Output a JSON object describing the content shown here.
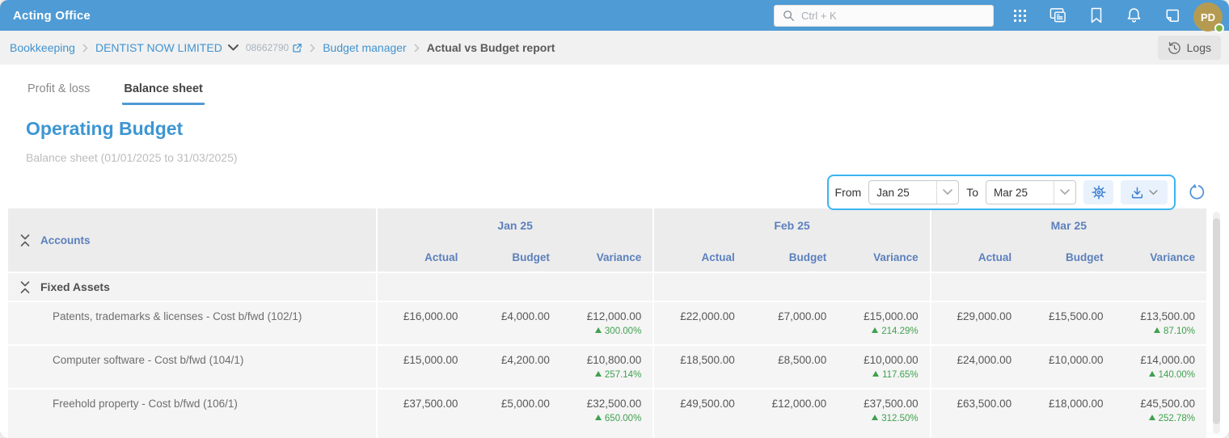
{
  "topbar": {
    "app_title": "Acting Office",
    "search_placeholder": "Ctrl + K",
    "avatar_initials": "PD",
    "icon_names": [
      "search-icon",
      "apps-grid-icon",
      "app-window-icon",
      "bookmark-icon",
      "notifications-bell-icon",
      "sticky-note-icon",
      "avatar-status-dot"
    ]
  },
  "breadcrumb": {
    "items": [
      "Bookkeeping",
      "DENTIST NOW LIMITED",
      "08662790",
      "Budget manager",
      "Actual vs Budget report"
    ],
    "logs_label": "Logs",
    "icon_names": [
      "company-dropdown-chevron-icon",
      "external-link-icon",
      "history-icon"
    ]
  },
  "tabs": {
    "profit_loss": "Profit & loss",
    "balance_sheet": "Balance sheet",
    "active": "Balance sheet"
  },
  "page": {
    "title": "Operating Budget",
    "subtitle": "Balance sheet (01/01/2025 to 31/03/2025)"
  },
  "filters": {
    "from_label": "From",
    "from_value": "Jan 25",
    "to_label": "To",
    "to_value": "Mar 25",
    "icon_names": [
      "gear-icon",
      "download-icon",
      "chevron-down-icon",
      "refresh-icon"
    ]
  },
  "table": {
    "accounts_header": "Accounts",
    "months": [
      "Jan 25",
      "Feb 25",
      "Mar 25"
    ],
    "sub_headers": [
      "Actual",
      "Budget",
      "Variance"
    ],
    "group_label": "Fixed Assets",
    "rows": [
      {
        "account": "Patents, trademarks & licenses - Cost b/fwd (102/1)",
        "months": [
          {
            "actual": "£16,000.00",
            "budget": "£4,000.00",
            "variance": "£12,000.00",
            "variance_pct": "300.00%"
          },
          {
            "actual": "£22,000.00",
            "budget": "£7,000.00",
            "variance": "£15,000.00",
            "variance_pct": "214.29%"
          },
          {
            "actual": "£29,000.00",
            "budget": "£15,500.00",
            "variance": "£13,500.00",
            "variance_pct": "87.10%"
          }
        ]
      },
      {
        "account": "Computer software - Cost b/fwd (104/1)",
        "months": [
          {
            "actual": "£15,000.00",
            "budget": "£4,200.00",
            "variance": "£10,800.00",
            "variance_pct": "257.14%"
          },
          {
            "actual": "£18,500.00",
            "budget": "£8,500.00",
            "variance": "£10,000.00",
            "variance_pct": "117.65%"
          },
          {
            "actual": "£24,000.00",
            "budget": "£10,000.00",
            "variance": "£14,000.00",
            "variance_pct": "140.00%"
          }
        ]
      },
      {
        "account": "Freehold property - Cost b/fwd (106/1)",
        "months": [
          {
            "actual": "£37,500.00",
            "budget": "£5,000.00",
            "variance": "£32,500.00",
            "variance_pct": "650.00%"
          },
          {
            "actual": "£49,500.00",
            "budget": "£12,000.00",
            "variance": "£37,500.00",
            "variance_pct": "312.50%"
          },
          {
            "actual": "£63,500.00",
            "budget": "£18,000.00",
            "variance": "£45,500.00",
            "variance_pct": "252.78%"
          }
        ]
      }
    ]
  },
  "colors": {
    "topbar_blue": "#4f9bd5",
    "link_blue": "#4193cf",
    "title_blue": "#3d96d3",
    "table_header_blue": "#5c80bd",
    "positive_green": "#3fa14e",
    "filter_border_blue": "#3ab5f0",
    "avatar_tan": "#b59b51",
    "status_green": "#7cb342"
  }
}
